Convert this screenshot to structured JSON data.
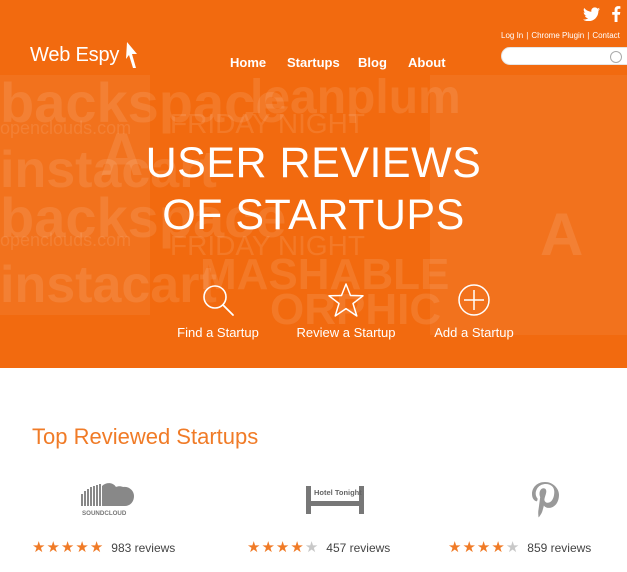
{
  "brand": {
    "name": "Web Espy"
  },
  "nav": [
    {
      "label": "Home"
    },
    {
      "label": "Startups"
    },
    {
      "label": "Blog"
    },
    {
      "label": "About"
    }
  ],
  "top_links": [
    "Log In",
    "Chrome Plugin",
    "Contact"
  ],
  "search": {
    "placeholder": ""
  },
  "hero": {
    "line1": "USER REVIEWS",
    "line2": "OF STARTUPS",
    "actions": [
      {
        "label": "Find a Startup",
        "icon": "magnifier-icon"
      },
      {
        "label": "Review a Startup",
        "icon": "star-outline-icon"
      },
      {
        "label": "Add a Startup",
        "icon": "plus-circle-icon"
      }
    ],
    "background_words": [
      "backspace",
      "leanplum",
      "FRIDAY NIGHT",
      "openclouds.com",
      "instacart",
      "MASHABLE",
      "ORPHIC"
    ]
  },
  "section": {
    "title": "Top Reviewed Startups"
  },
  "startups": [
    {
      "name": "SOUNDCLOUD",
      "rating": 5,
      "reviews": "983 reviews"
    },
    {
      "name": "Hotel Tonight",
      "rating": 4,
      "reviews": "457 reviews"
    },
    {
      "name": "Pinterest",
      "rating": 4,
      "reviews": "859 reviews"
    }
  ],
  "colors": {
    "brand_orange": "#f26a0f",
    "accent_orange": "#f07b27",
    "star_off": "#c8c8c8"
  }
}
